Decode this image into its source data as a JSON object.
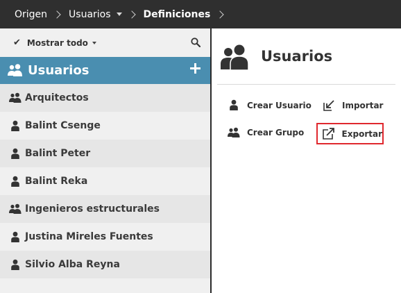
{
  "breadcrumb": {
    "items": [
      "Origen",
      "Usuarios",
      "Definiciones"
    ]
  },
  "filter": {
    "label": "Mostrar todo"
  },
  "list_header": {
    "title": "Usuarios"
  },
  "items": [
    {
      "label": "Arquitectos",
      "type": "group"
    },
    {
      "label": "Balint Csenge",
      "type": "user"
    },
    {
      "label": "Balint Peter",
      "type": "user"
    },
    {
      "label": "Balint Reka",
      "type": "user"
    },
    {
      "label": "Ingenieros estructurales",
      "type": "group"
    },
    {
      "label": "Justina Mireles Fuentes",
      "type": "user"
    },
    {
      "label": "Silvio Alba Reyna",
      "type": "user"
    }
  ],
  "panel": {
    "title": "Usuarios",
    "actions": {
      "crear_usuario": "Crear Usuario",
      "importar": "Importar",
      "crear_grupo": "Crear Grupo",
      "exportar": "Exportar"
    }
  },
  "colors": {
    "topbar": "#2f2f2f",
    "header_accent": "#4a8eb0",
    "highlight_border": "#e0282e"
  },
  "icons": {
    "group": "users-icon",
    "user": "user-icon",
    "search": "search-icon",
    "add": "plus-icon",
    "import": "import-icon",
    "export": "export-icon"
  }
}
